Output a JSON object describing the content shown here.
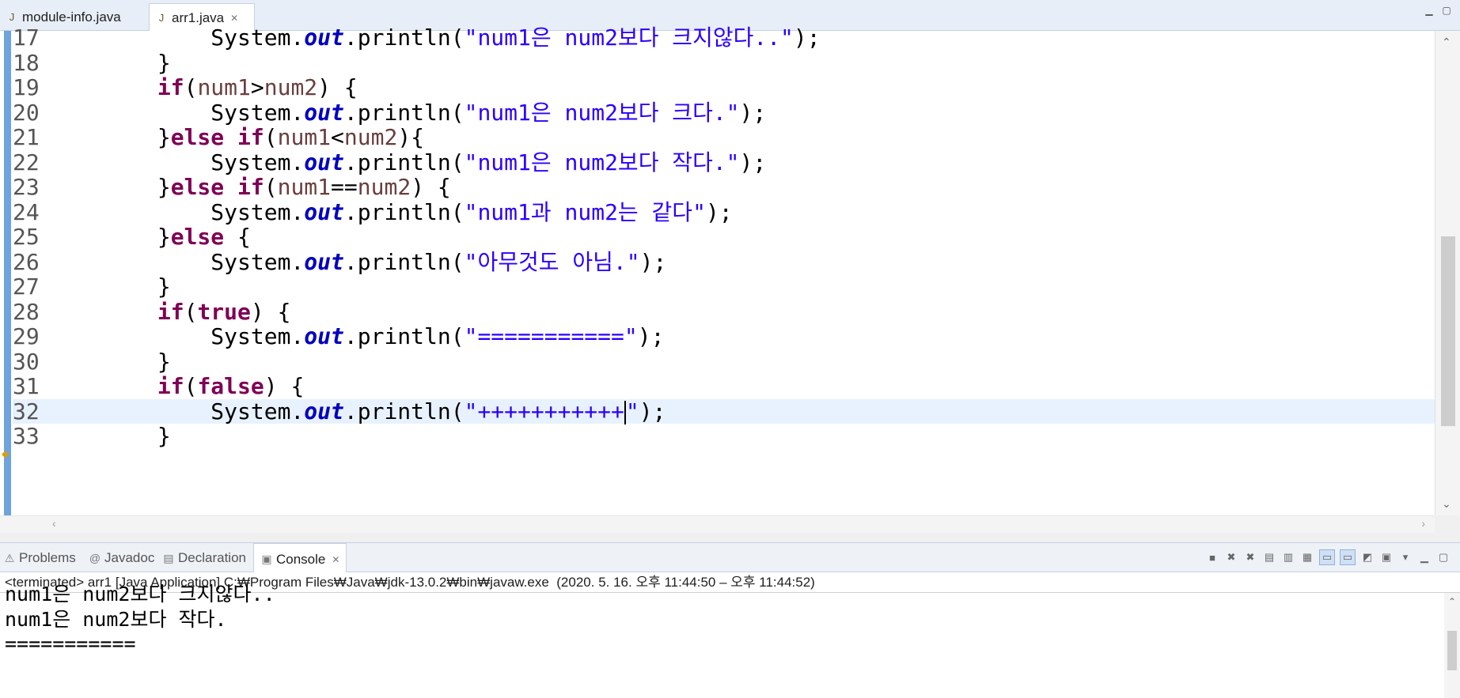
{
  "editor_tabs": [
    {
      "label": "module-info.java",
      "active": false
    },
    {
      "label": "arr1.java",
      "active": true
    }
  ],
  "close_glyph": "✕",
  "code_lines": [
    {
      "num": "17",
      "parts": [
        [
          "",
          "            System."
        ],
        [
          "fld",
          "out"
        ],
        [
          "",
          ".println("
        ],
        [
          "str",
          "\"num1은 num2보다 크지않다..\""
        ],
        [
          "",
          ");"
        ]
      ]
    },
    {
      "num": "18",
      "parts": [
        [
          "",
          "        }"
        ]
      ]
    },
    {
      "num": "19",
      "parts": [
        [
          "",
          "        "
        ],
        [
          "kw",
          "if"
        ],
        [
          "",
          "("
        ],
        [
          "var",
          "num1"
        ],
        [
          "",
          ">"
        ],
        [
          "var",
          "num2"
        ],
        [
          "",
          ") {"
        ]
      ]
    },
    {
      "num": "20",
      "parts": [
        [
          "",
          "            System."
        ],
        [
          "fld",
          "out"
        ],
        [
          "",
          ".println("
        ],
        [
          "str",
          "\"num1은 num2보다 크다.\""
        ],
        [
          "",
          ");"
        ]
      ]
    },
    {
      "num": "21",
      "parts": [
        [
          "",
          "        }"
        ],
        [
          "kw",
          "else if"
        ],
        [
          "",
          "("
        ],
        [
          "var",
          "num1"
        ],
        [
          "",
          "<"
        ],
        [
          "var",
          "num2"
        ],
        [
          "",
          "){"
        ]
      ]
    },
    {
      "num": "22",
      "parts": [
        [
          "",
          "            System."
        ],
        [
          "fld",
          "out"
        ],
        [
          "",
          ".println("
        ],
        [
          "str",
          "\"num1은 num2보다 작다.\""
        ],
        [
          "",
          ");"
        ]
      ]
    },
    {
      "num": "23",
      "parts": [
        [
          "",
          "        }"
        ],
        [
          "kw",
          "else if"
        ],
        [
          "",
          "("
        ],
        [
          "var",
          "num1"
        ],
        [
          "",
          "=="
        ],
        [
          "var",
          "num2"
        ],
        [
          "",
          ") {"
        ]
      ]
    },
    {
      "num": "24",
      "parts": [
        [
          "",
          "            System."
        ],
        [
          "fld",
          "out"
        ],
        [
          "",
          ".println("
        ],
        [
          "str",
          "\"num1과 num2는 같다\""
        ],
        [
          "",
          ");"
        ]
      ]
    },
    {
      "num": "25",
      "parts": [
        [
          "",
          "        }"
        ],
        [
          "kw",
          "else"
        ],
        [
          "",
          " {"
        ]
      ]
    },
    {
      "num": "26",
      "parts": [
        [
          "",
          "            System."
        ],
        [
          "fld",
          "out"
        ],
        [
          "",
          ".println("
        ],
        [
          "str",
          "\"아무것도 아님.\""
        ],
        [
          "",
          ");"
        ]
      ]
    },
    {
      "num": "27",
      "parts": [
        [
          "",
          "        }"
        ]
      ]
    },
    {
      "num": "28",
      "parts": [
        [
          "",
          "        "
        ],
        [
          "kw",
          "if"
        ],
        [
          "",
          "("
        ],
        [
          "kw",
          "true"
        ],
        [
          "",
          ") {"
        ]
      ]
    },
    {
      "num": "29",
      "parts": [
        [
          "",
          "            System."
        ],
        [
          "fld",
          "out"
        ],
        [
          "",
          ".println("
        ],
        [
          "str",
          "\"===========\""
        ],
        [
          "",
          ");"
        ]
      ]
    },
    {
      "num": "30",
      "parts": [
        [
          "",
          "        }"
        ]
      ]
    },
    {
      "num": "31",
      "parts": [
        [
          "",
          "        "
        ],
        [
          "kw",
          "if"
        ],
        [
          "",
          "("
        ],
        [
          "kw",
          "false"
        ],
        [
          "",
          ") {"
        ]
      ]
    },
    {
      "num": "32",
      "current": true,
      "parts": [
        [
          "",
          "            System."
        ],
        [
          "fld",
          "out"
        ],
        [
          "",
          ".println("
        ],
        [
          "str",
          "\"+++++++++++"
        ],
        [
          "caret",
          ""
        ],
        [
          "str",
          "\""
        ],
        [
          "",
          ");"
        ]
      ]
    },
    {
      "num": "33",
      "parts": [
        [
          "",
          "        }"
        ]
      ]
    }
  ],
  "view_tabs": [
    {
      "key": "problems",
      "label": "Problems",
      "icon": "problems-icon",
      "glyph": "⚠"
    },
    {
      "key": "javadoc",
      "label": "Javadoc",
      "icon": "at-icon",
      "glyph": "@"
    },
    {
      "key": "decl",
      "label": "Declaration",
      "icon": "declaration-icon",
      "glyph": "▤"
    },
    {
      "key": "console",
      "label": "Console",
      "icon": "console-icon",
      "glyph": "▣"
    }
  ],
  "console": {
    "header": "<terminated> arr1 [Java Application] C:₩Program Files₩Java₩jdk-13.0.2₩bin₩javaw.exe  (2020. 5. 16. 오후 11:44:50 – 오후 11:44:52)",
    "output": [
      "num1은 num2보다 크지않다..",
      "num1은 num2보다 작다.",
      "==========="
    ]
  },
  "toolbar_icons": [
    "terminate-icon",
    "remove-launch-icon",
    "remove-all-icon",
    "clear-console-icon",
    "scroll-lock-icon",
    "word-wrap-icon",
    "show-on-stdout-icon",
    "show-on-stderr-icon",
    "pin-console-icon",
    "display-console-icon",
    "open-console-icon",
    "minimize-icon",
    "maximize-icon"
  ]
}
